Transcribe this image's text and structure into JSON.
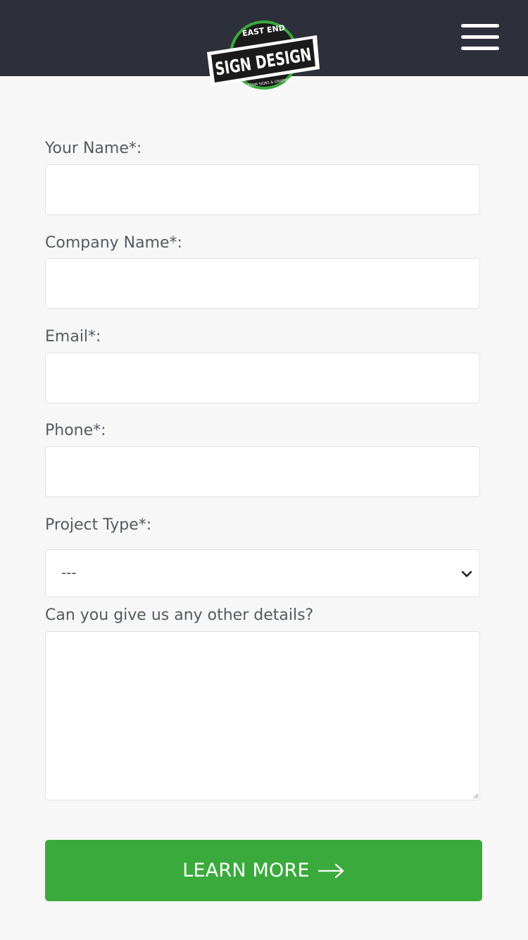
{
  "header": {
    "logo": {
      "top_text": "EAST END",
      "main_text": "SIGN DESIGN",
      "bottom_text": "CUSTOM SIGNS & GRAPHICS",
      "accent_color": "#3aaa3d"
    },
    "menu_icon": "hamburger-icon"
  },
  "form": {
    "name_label": "Your Name*:",
    "name_value": "",
    "company_label": "Company Name*:",
    "company_value": "",
    "email_label": "Email*:",
    "email_value": "",
    "phone_label": "Phone*:",
    "phone_value": "",
    "project_type_label": "Project Type*:",
    "project_type_selected": "---",
    "details_label": "Can you give us any other details?",
    "details_value": "",
    "submit_label": "LEARN MORE",
    "submit_icon": "arrow-right-icon"
  },
  "colors": {
    "header_bg": "#2d303b",
    "page_bg": "#f7f7f7",
    "button_bg": "#3aaa3d",
    "label_text": "#555a61"
  }
}
